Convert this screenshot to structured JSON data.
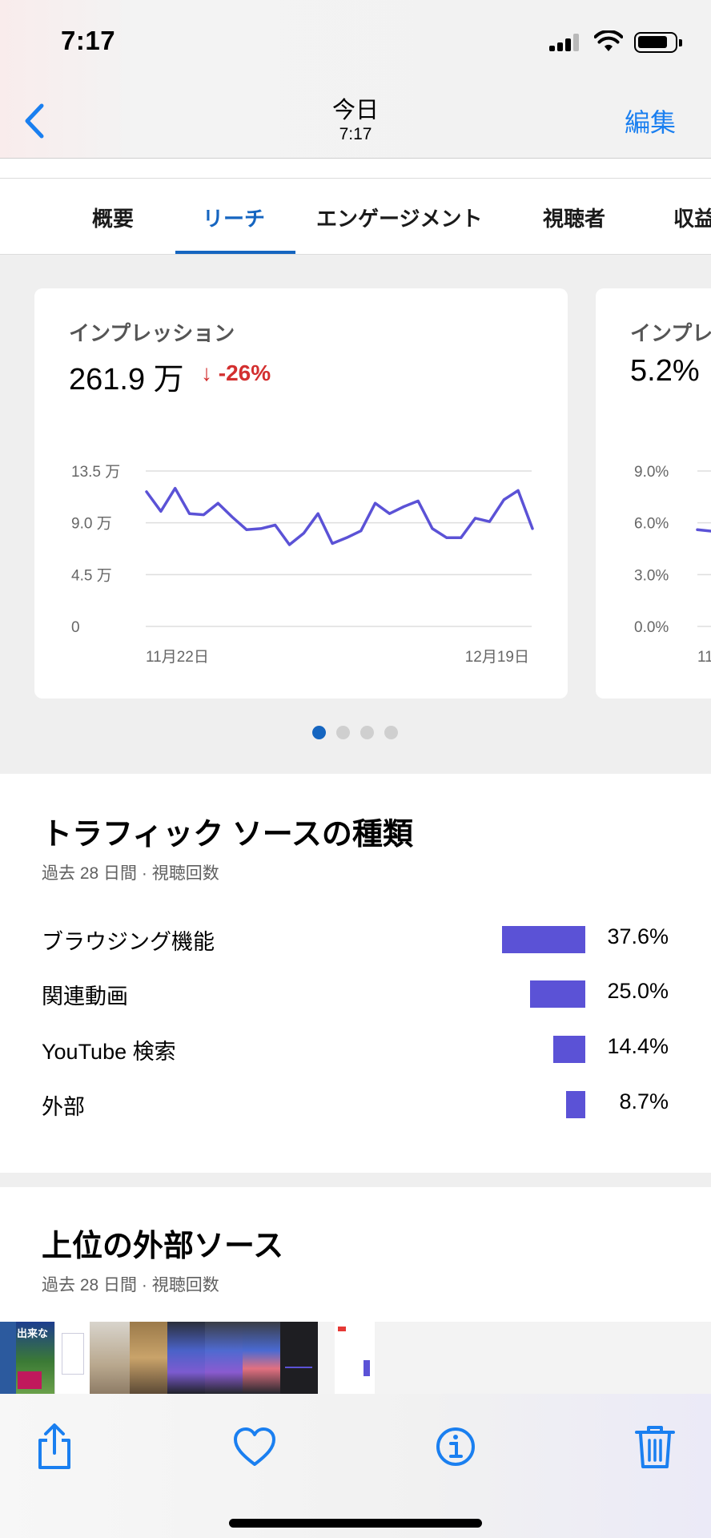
{
  "status": {
    "time": "7:17"
  },
  "header": {
    "title": "今日",
    "subtitle": "7:17",
    "edit_label": "編集"
  },
  "tabs": [
    {
      "label": "概要"
    },
    {
      "label": "リーチ"
    },
    {
      "label": "エンゲージメント"
    },
    {
      "label": "視聴者"
    },
    {
      "label": "収益"
    }
  ],
  "active_tab": "リーチ",
  "cards": [
    {
      "label": "インプレッション",
      "value": "261.9 万",
      "delta": "↓ -26%"
    },
    {
      "label": "インプレッションのクリック率",
      "value": "5.2%"
    }
  ],
  "chart_data": [
    {
      "type": "line",
      "x_start": "11月22日",
      "x_end": "12月19日",
      "y_ticks": [
        "13.5 万",
        "9.0 万",
        "4.5 万",
        "0"
      ],
      "ylim": [
        0,
        13.5
      ],
      "grid": true,
      "color": "#5b52d6",
      "values": [
        11.7,
        10.0,
        12.0,
        9.8,
        9.7,
        10.7,
        9.5,
        8.4,
        8.5,
        8.8,
        7.1,
        8.1,
        9.8,
        7.2,
        7.7,
        8.3,
        10.7,
        9.8,
        10.4,
        10.9,
        8.5,
        7.7,
        7.7,
        9.4,
        9.1,
        11.0,
        11.8,
        8.5
      ]
    },
    {
      "type": "line",
      "x_start": "11",
      "y_ticks": [
        "9.0%",
        "6.0%",
        "3.0%",
        "0.0%"
      ],
      "ylim": [
        0,
        9.0
      ],
      "grid": true,
      "color": "#5b52d6",
      "values": [
        5.6,
        5.5
      ]
    }
  ],
  "carousel": {
    "pages": 4,
    "active": 0
  },
  "traffic": {
    "title": "トラフィック ソースの種類",
    "subtitle": "過去 28 日間 · 視聴回数",
    "rows": [
      {
        "label": "ブラウジング機能",
        "value": "37.6%",
        "percent": 37.6
      },
      {
        "label": "関連動画",
        "value": "25.0%",
        "percent": 25.0
      },
      {
        "label": "YouTube 検索",
        "value": "14.4%",
        "percent": 14.4
      },
      {
        "label": "外部",
        "value": "8.7%",
        "percent": 8.7
      }
    ],
    "bar_color": "#5b52d6"
  },
  "external": {
    "title": "上位の外部ソース",
    "subtitle": "過去 28 日間 · 視聴回数"
  },
  "thumbnails": [
    {
      "text": "出来な"
    },
    {
      "text": ""
    },
    {
      "text": ""
    },
    {
      "text": ""
    },
    {
      "text": ""
    },
    {
      "text": ""
    },
    {
      "text": ""
    },
    {
      "text": ""
    },
    {
      "text": ""
    },
    {
      "text": ""
    }
  ],
  "toolbar": {
    "share": "share-icon",
    "favorite": "heart-icon",
    "info": "info-icon",
    "delete": "trash-icon"
  }
}
